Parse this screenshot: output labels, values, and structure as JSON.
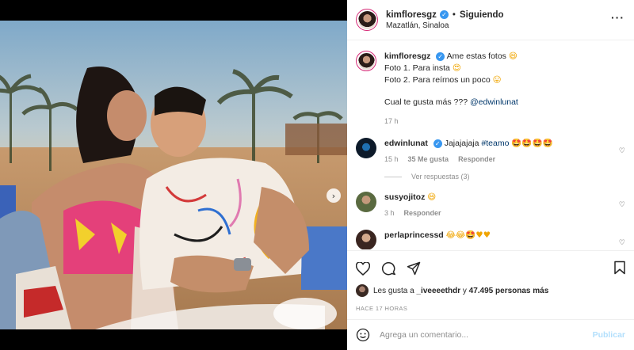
{
  "post": {
    "username": "kimfloresgz",
    "follow_status": "Siguiendo",
    "separator": "•",
    "location": "Mazatlán, Sinaloa",
    "more_icon": "more-icon",
    "carousel_next_glyph": "›"
  },
  "caption": {
    "username": "kimfloresgz",
    "line1": "Ame estas fotos",
    "emoji1": "😄",
    "line2": "Foto 1. Para insta",
    "emoji2": "😍",
    "line3": "Foto 2. Para reírnos un poco",
    "emoji3": "😛",
    "line4": "Cual te gusta más ???",
    "mention": "@edwinlunat",
    "time": "17 h"
  },
  "comments": [
    {
      "username": "edwinlunat",
      "text": "Jajajajaja",
      "hashtag": "#teamo",
      "emojis": "🤩🤩🤩🤩",
      "time": "15 h",
      "likes": "35 Me gusta",
      "reply": "Responder",
      "view_replies": "Ver respuestas (3)"
    },
    {
      "username": "susyojitoz",
      "text": "",
      "emojis": "😄",
      "time": "3 h",
      "reply": "Responder"
    },
    {
      "username": "perlaprincessd",
      "text": "",
      "emojis": "😂😂🤩♥♥"
    }
  ],
  "actions": {
    "likes_prefix": "Les gusta a",
    "liker": "_iveeeethdr",
    "likes_middle": "y",
    "likes_count": "47.495 personas más",
    "time_ago": "HACE 17 HORAS"
  },
  "comment_box": {
    "placeholder": "Agrega un comentario...",
    "publish": "Publicar",
    "emoji_icon": "smiley-icon"
  },
  "colors": {
    "verified": "#3897f0",
    "link": "#00376b",
    "publish_disabled": "#b2dffc",
    "story_ring": "#d62976"
  }
}
